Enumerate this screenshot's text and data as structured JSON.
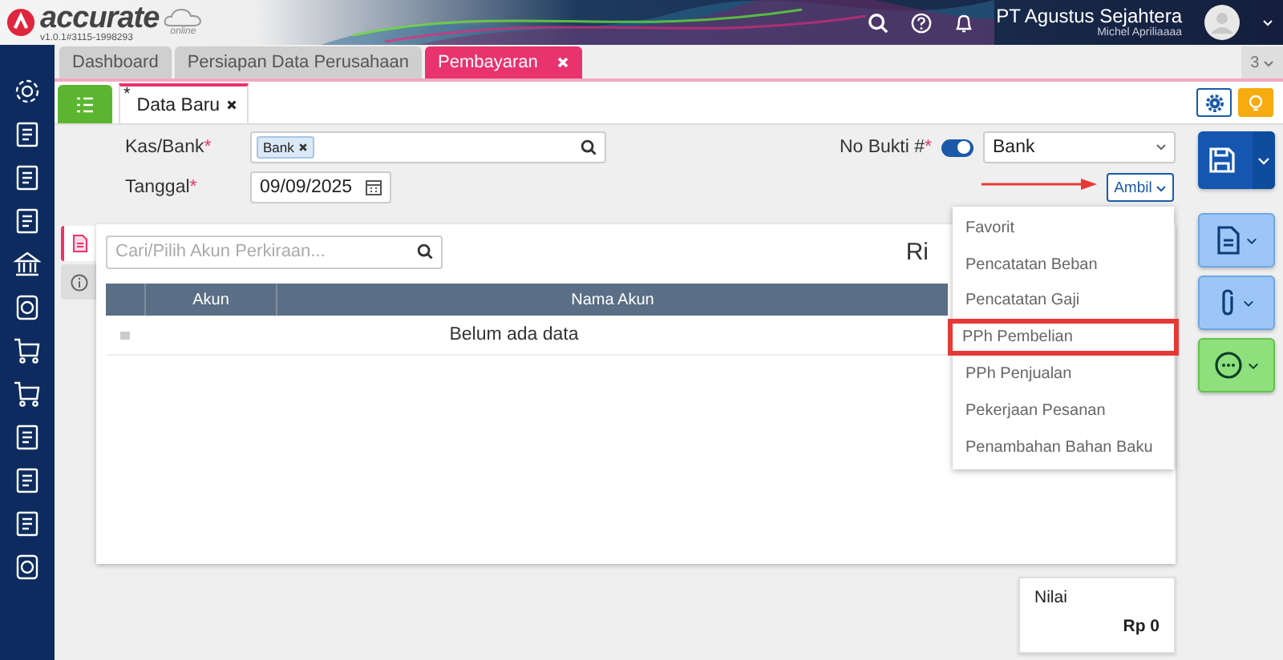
{
  "header": {
    "logo_text": "accurate",
    "logo_sub": "online",
    "version": "v1.0.1#3115-1998293",
    "company": "PT Agustus Sejahtera",
    "user": "Michel Apriliaaaa"
  },
  "tabs": [
    {
      "label": "Dashboard",
      "selected": false,
      "closable": false
    },
    {
      "label": "Persiapan Data Perusahaan",
      "selected": false,
      "closable": false
    },
    {
      "label": "Pembayaran",
      "selected": true,
      "closable": true
    }
  ],
  "tab_count": "3",
  "subtabs": [
    {
      "label": "Data Baru",
      "modified": true,
      "selected": true
    }
  ],
  "modified_mark": "*",
  "form": {
    "kas_bank": {
      "label": "Kas/Bank",
      "required": true,
      "chips": [
        "Bank"
      ]
    },
    "no_bukti": {
      "label": "No Bukti #",
      "required": true,
      "toggle_on": true,
      "value": "Bank"
    },
    "tanggal": {
      "label": "Tanggal",
      "required": true,
      "value": "09/09/2025"
    },
    "required_mark": "*"
  },
  "ambil_button": "Ambil",
  "panel": {
    "search": {
      "placeholder": "Cari/Pilih Akun Perkiraan..."
    },
    "title": "Ri",
    "columns": [
      "Akun",
      "Nama Akun"
    ],
    "empty_text": "Belum ada data"
  },
  "dropdown": [
    {
      "label": "Favorit",
      "highlighted": false
    },
    {
      "label": "Pencatatan Beban",
      "highlighted": false
    },
    {
      "label": "Pencatatan Gaji",
      "highlighted": false
    },
    {
      "label": "PPh Pembelian",
      "highlighted": true
    },
    {
      "label": "PPh Penjualan",
      "highlighted": false
    },
    {
      "label": "Pekerjaan Pesanan",
      "highlighted": false
    },
    {
      "label": "Penambahan Bahan Baku",
      "highlighted": false
    }
  ],
  "total": {
    "label": "Nilai",
    "value": "Rp 0"
  }
}
